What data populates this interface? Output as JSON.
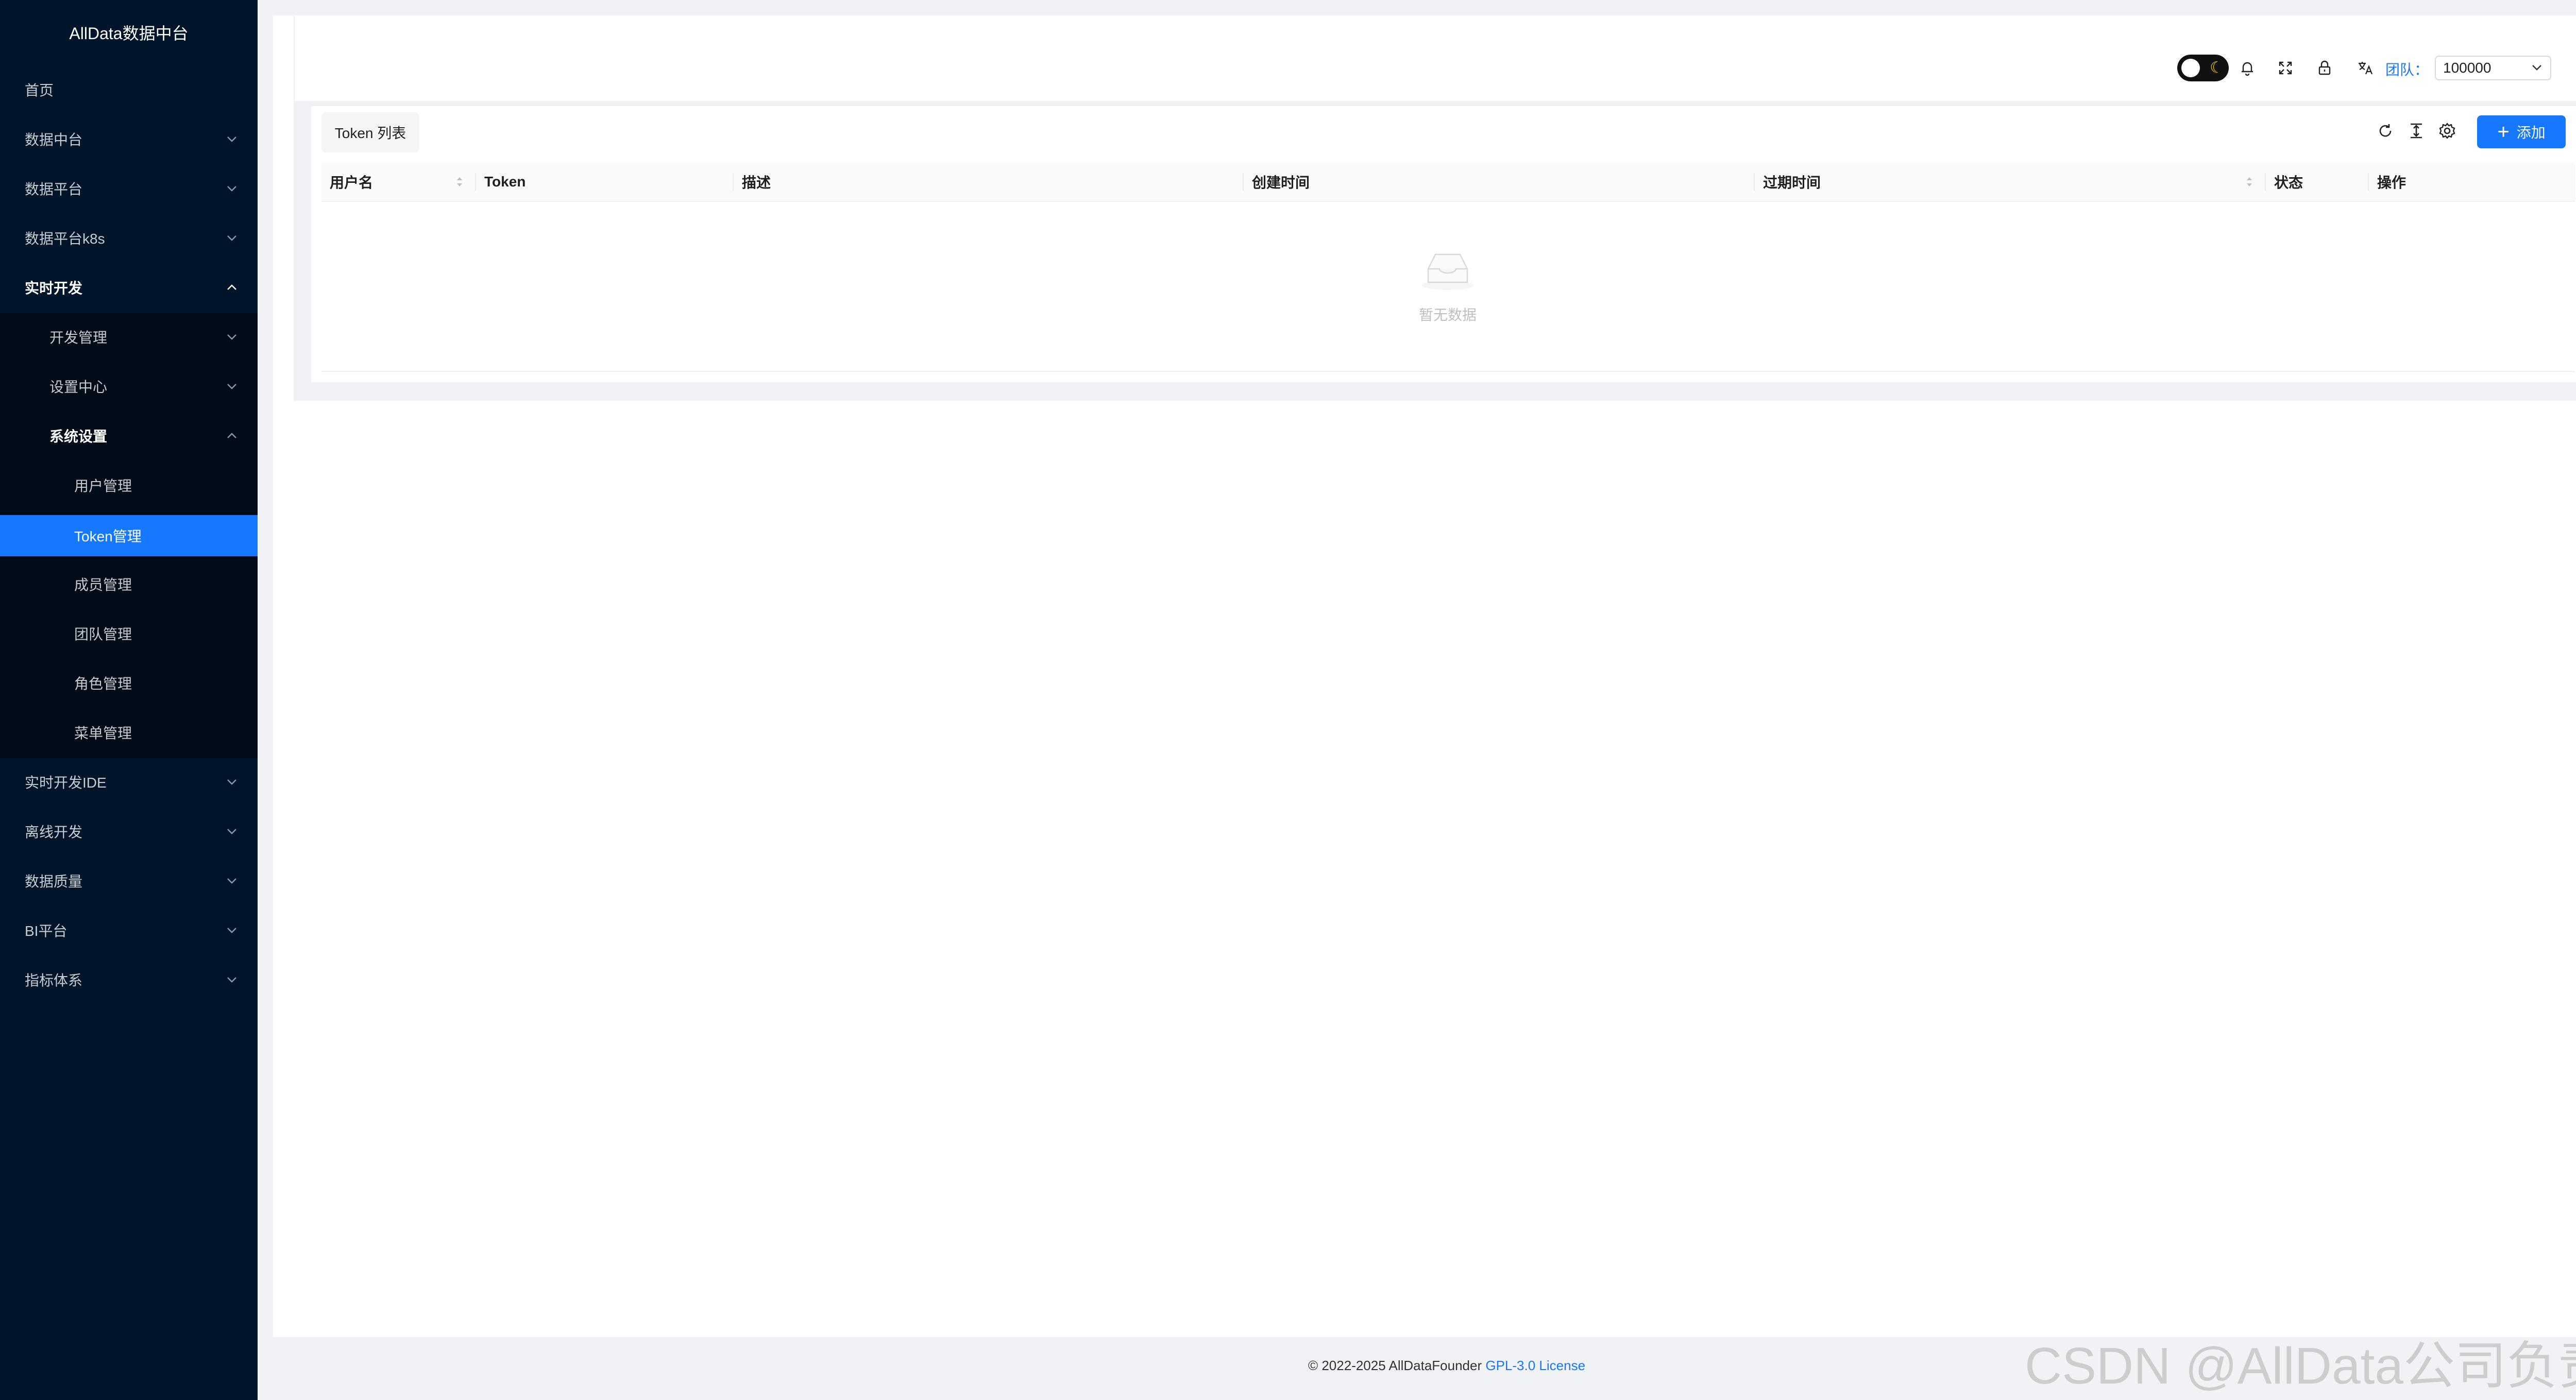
{
  "app": {
    "title": "AllData数据中台"
  },
  "sidebar": {
    "items": [
      {
        "label": "首页"
      },
      {
        "label": "数据中台"
      },
      {
        "label": "数据平台"
      },
      {
        "label": "数据平台k8s"
      },
      {
        "label": "实时开发"
      },
      {
        "label": "开发管理"
      },
      {
        "label": "设置中心"
      },
      {
        "label": "系统设置"
      },
      {
        "label": "用户管理"
      },
      {
        "label": "Token管理"
      },
      {
        "label": "成员管理"
      },
      {
        "label": "团队管理"
      },
      {
        "label": "角色管理"
      },
      {
        "label": "菜单管理"
      },
      {
        "label": "实时开发IDE"
      },
      {
        "label": "离线开发"
      },
      {
        "label": "数据质量"
      },
      {
        "label": "BI平台"
      },
      {
        "label": "指标体系"
      }
    ],
    "active_item": "Token管理"
  },
  "header": {
    "team_label": "团队：",
    "team_value": "100000",
    "icons": [
      "theme-toggle",
      "bell-icon",
      "fullscreen-icon",
      "lock-icon",
      "translate-icon"
    ]
  },
  "table": {
    "tab_title": "Token 列表",
    "add_button": "添加",
    "columns": [
      "用户名",
      "Token",
      "描述",
      "创建时间",
      "过期时间",
      "状态",
      "操作"
    ],
    "rows": [],
    "empty_text": "暂无数据"
  },
  "footer": {
    "copyright": "© 2022-2025 AllDataFounder ",
    "license": "GPL-3.0 License"
  },
  "watermark": "CSDN @AllData公司负责人",
  "colors": {
    "sidebar_bg": "#001529",
    "submenu_bg": "#000c17",
    "accent": "#1677ff"
  }
}
